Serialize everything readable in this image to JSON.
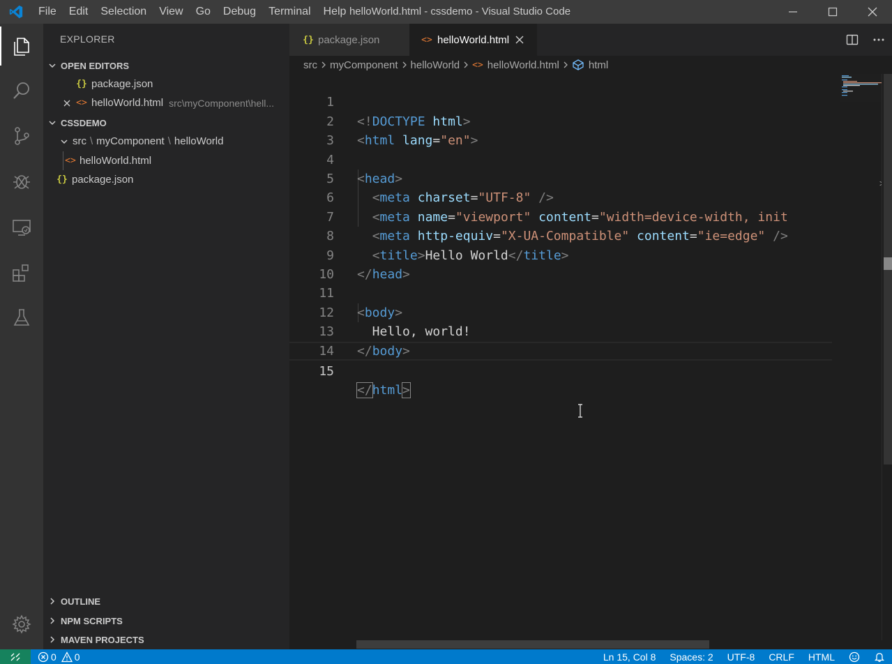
{
  "window": {
    "title": "helloWorld.html - cssdemo - Visual Studio Code",
    "menu": [
      "File",
      "Edit",
      "Selection",
      "View",
      "Go",
      "Debug",
      "Terminal",
      "Help"
    ]
  },
  "activity_bar": [
    "explorer-icon",
    "search-icon",
    "source-control-icon",
    "debug-icon",
    "remote-explorer-icon",
    "extensions-icon",
    "test-icon",
    "settings-gear-icon"
  ],
  "sidebar": {
    "title": "EXPLORER",
    "open_editors": {
      "label": "OPEN EDITORS",
      "items": [
        {
          "name": "package.json",
          "path": ""
        },
        {
          "name": "helloWorld.html",
          "path": "src\\myComponent\\hell..."
        }
      ]
    },
    "project": {
      "label": "CSSDEMO",
      "folder_path": [
        "src",
        "myComponent",
        "helloWorld"
      ],
      "file_in_folder": "helloWorld.html",
      "root_file": "package.json"
    },
    "outline": "OUTLINE",
    "npm_scripts": "NPM SCRIPTS",
    "maven_projects": "MAVEN PROJECTS"
  },
  "tabs": [
    {
      "label": "package.json",
      "active": false
    },
    {
      "label": "helloWorld.html",
      "active": true
    }
  ],
  "breadcrumb": [
    "src",
    "myComponent",
    "helloWorld",
    "helloWorld.html",
    "html"
  ],
  "code_lines": [
    {
      "n": "1"
    },
    {
      "n": "2"
    },
    {
      "n": "3"
    },
    {
      "n": "4"
    },
    {
      "n": "5"
    },
    {
      "n": "6"
    },
    {
      "n": "7"
    },
    {
      "n": "8"
    },
    {
      "n": "9"
    },
    {
      "n": "10"
    },
    {
      "n": "11"
    },
    {
      "n": "12"
    },
    {
      "n": "13"
    },
    {
      "n": "14"
    },
    {
      "n": "15"
    }
  ],
  "code_tokens": {
    "l1": [
      "<!",
      "DOCTYPE",
      " ",
      "html",
      ">"
    ],
    "l2": [
      "<",
      "html",
      " ",
      "lang",
      "=",
      "\"en\"",
      ">"
    ],
    "l4": [
      "<",
      "head",
      ">"
    ],
    "l5": [
      "  ",
      "<",
      "meta",
      " ",
      "charset",
      "=",
      "\"UTF-8\"",
      " />"
    ],
    "l6": [
      "  ",
      "<",
      "meta",
      " ",
      "name",
      "=",
      "\"viewport\"",
      " ",
      "content",
      "=",
      "\"width=device-width, init"
    ],
    "l7": [
      "  ",
      "<",
      "meta",
      " ",
      "http-equiv",
      "=",
      "\"X-UA-Compatible\"",
      " ",
      "content",
      "=",
      "\"ie=edge\"",
      " />"
    ],
    "l8": [
      "  ",
      "<",
      "title",
      ">",
      "Hello World",
      "</",
      "title",
      ">"
    ],
    "l9": [
      "</",
      "head",
      ">"
    ],
    "l11": [
      "<",
      "body",
      ">"
    ],
    "l12": [
      "  Hello, world!"
    ],
    "l13": [
      "</",
      "body",
      ">"
    ],
    "l15": [
      "</",
      "html",
      ">"
    ]
  },
  "status_bar": {
    "errors": "0",
    "warnings": "0",
    "position": "Ln 15, Col 8",
    "spaces": "Spaces: 2",
    "encoding": "UTF-8",
    "eol": "CRLF",
    "language": "HTML"
  },
  "colors": {
    "accent": "#007acc",
    "remote": "#16825d",
    "tag": "#569cd6",
    "attr": "#9cdcfe",
    "string": "#ce9178"
  }
}
